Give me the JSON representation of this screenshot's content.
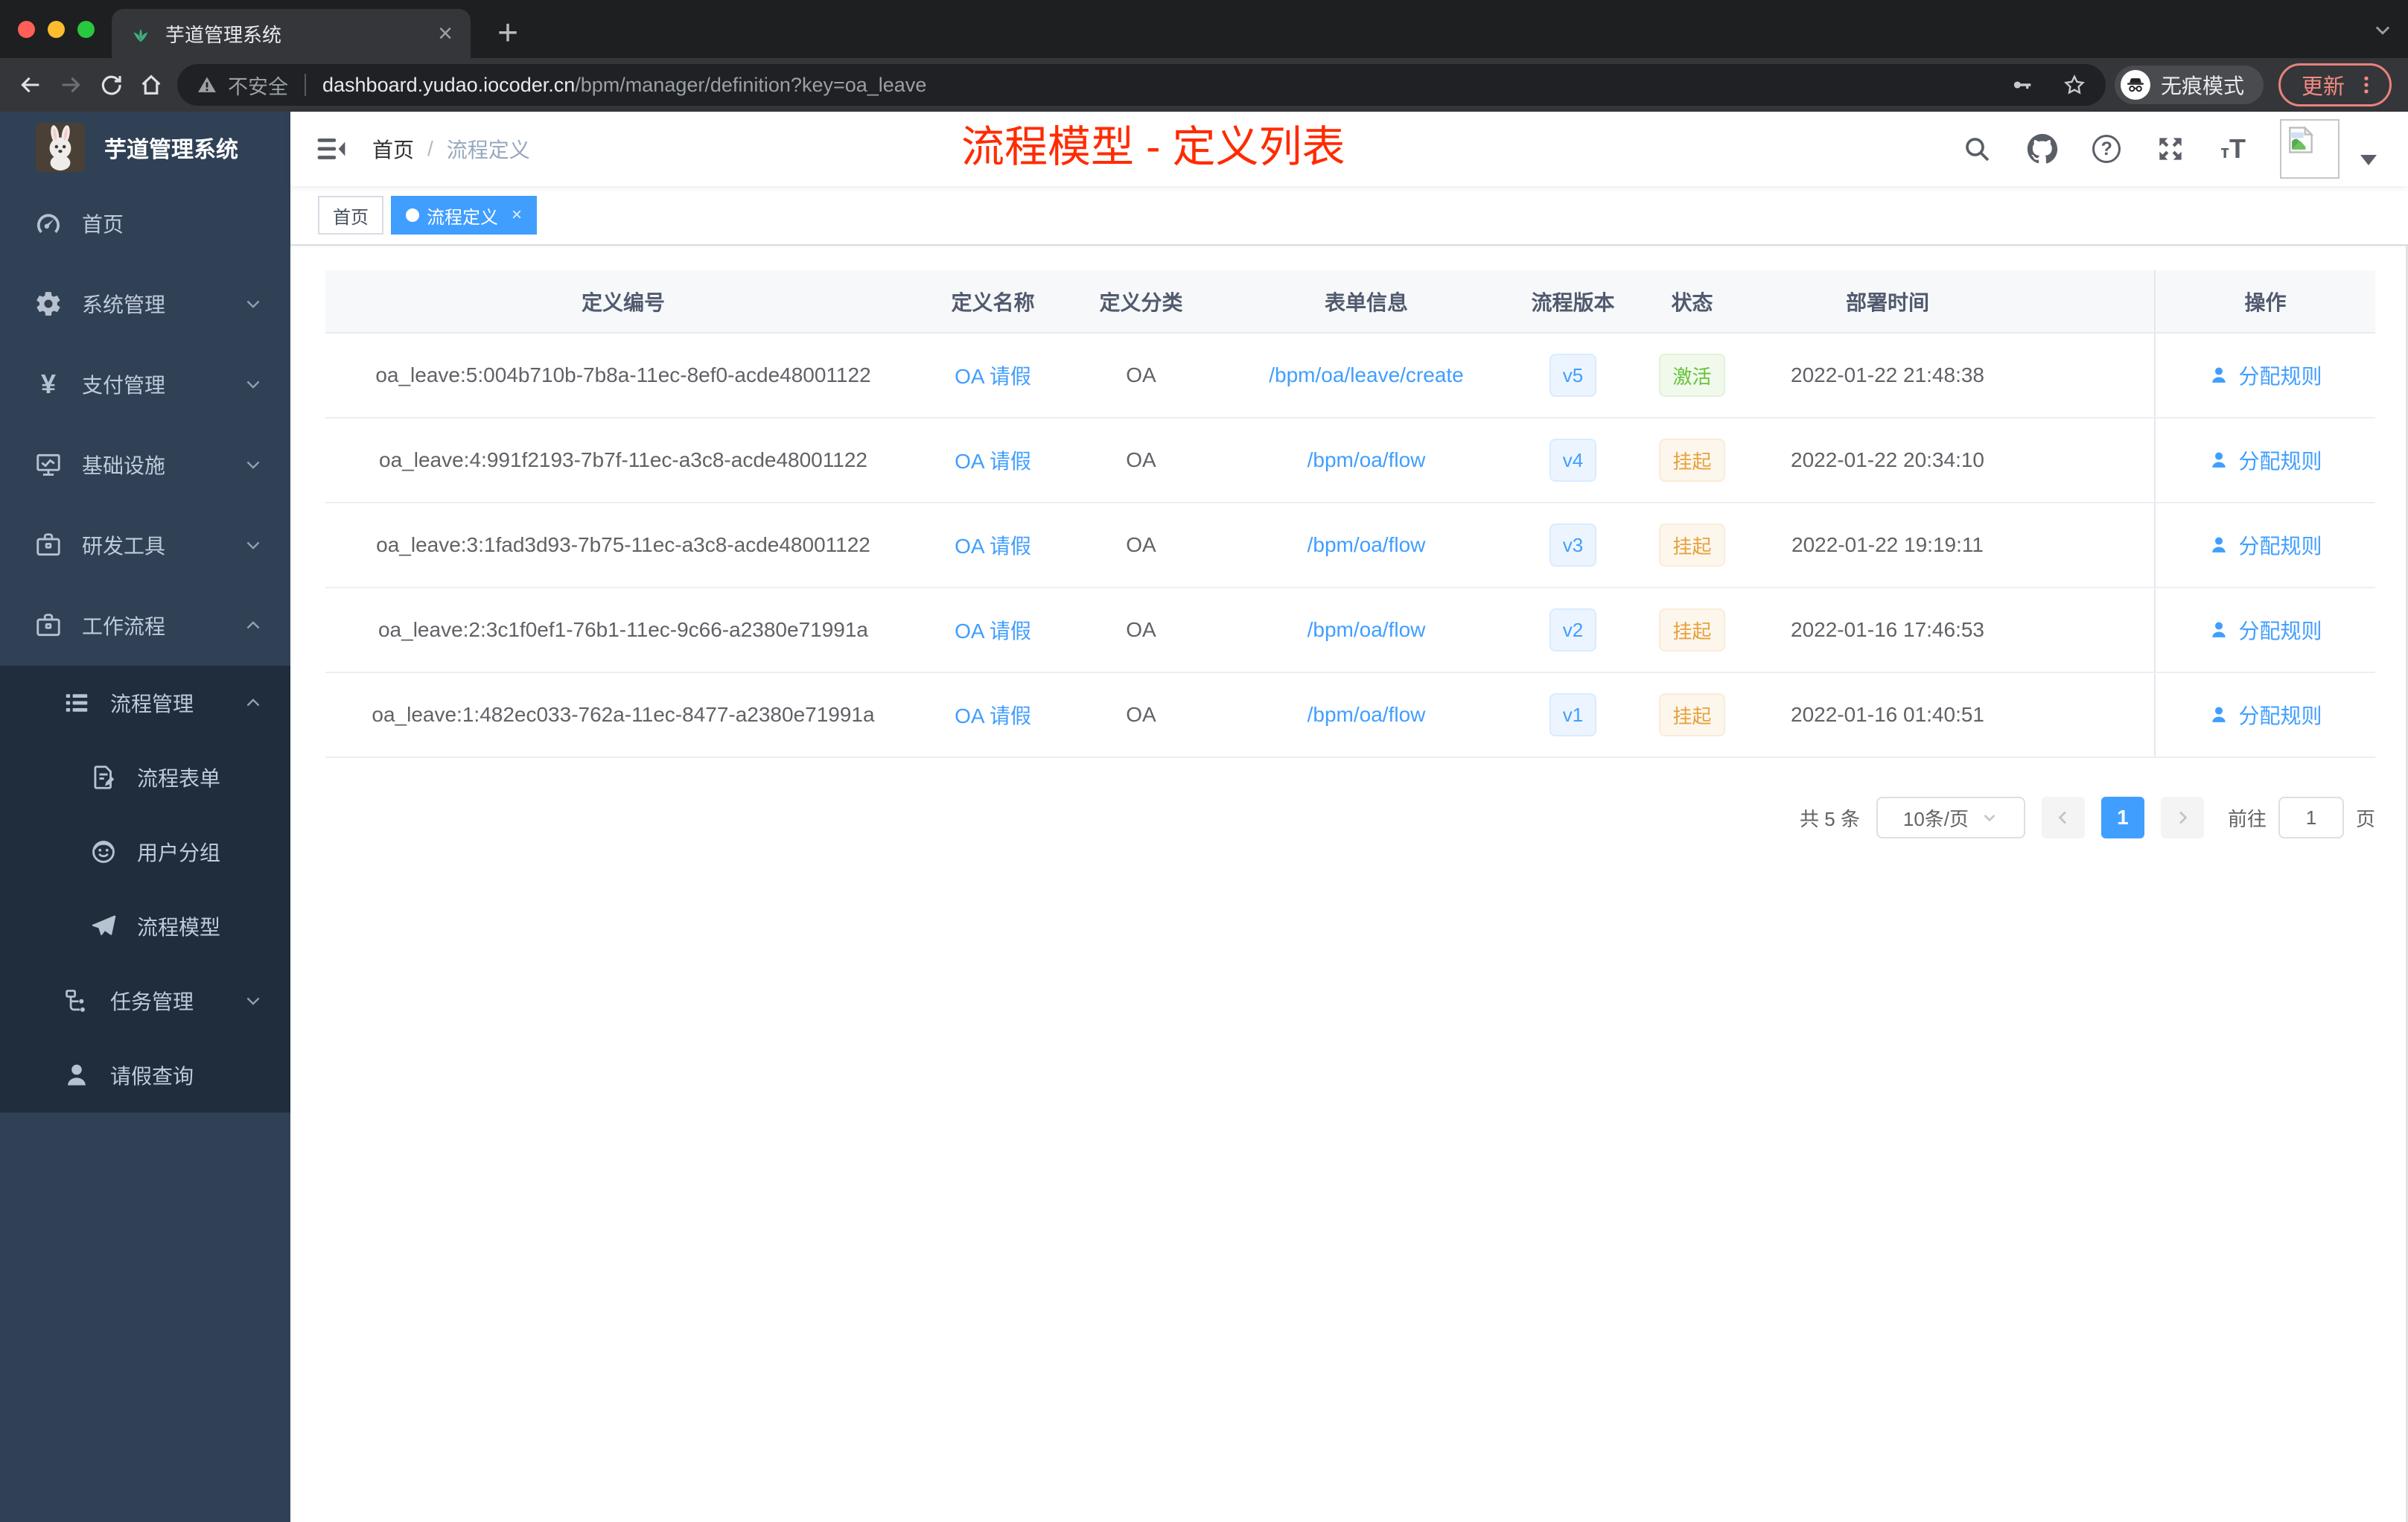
{
  "browser": {
    "tab_title": "芋道管理系统",
    "security_label": "不安全",
    "url_domain": "dashboard.yudao.iocoder.cn",
    "url_path": "/bpm/manager/definition?key=oa_leave",
    "incognito_label": "无痕模式",
    "update_label": "更新",
    "icons": [
      "back-icon",
      "forward-icon",
      "reload-icon",
      "home-icon",
      "warning-icon",
      "key-icon",
      "star-icon",
      "incognito-icon",
      "more-dots-icon",
      "tab-leaf-favicon-icon",
      "close-icon",
      "new-tab-icon",
      "tab-search-icon"
    ]
  },
  "sidebar": {
    "logo_title": "芋道管理系统",
    "items": [
      {
        "label": "首页",
        "icon": "dashboard-icon",
        "level": 1,
        "chevron": null
      },
      {
        "label": "系统管理",
        "icon": "gear-icon",
        "level": 1,
        "chevron": "down"
      },
      {
        "label": "支付管理",
        "icon": "yen-icon",
        "level": 1,
        "chevron": "down"
      },
      {
        "label": "基础设施",
        "icon": "monitor-chart-icon",
        "level": 1,
        "chevron": "down"
      },
      {
        "label": "研发工具",
        "icon": "toolbox-icon",
        "level": 1,
        "chevron": "down"
      },
      {
        "label": "工作流程",
        "icon": "briefcase-icon",
        "level": 1,
        "chevron": "up"
      },
      {
        "label": "流程管理",
        "icon": "list-icon",
        "level": 2,
        "chevron": "up"
      },
      {
        "label": "流程表单",
        "icon": "form-edit-icon",
        "level": 3,
        "chevron": null
      },
      {
        "label": "用户分组",
        "icon": "user-group-icon",
        "level": 3,
        "chevron": null
      },
      {
        "label": "流程模型",
        "icon": "paper-plane-icon",
        "level": 3,
        "chevron": null
      },
      {
        "label": "任务管理",
        "icon": "org-tree-icon",
        "level": 2,
        "chevron": "down"
      },
      {
        "label": "请假查询",
        "icon": "user-icon",
        "level": 2,
        "chevron": null
      }
    ]
  },
  "header": {
    "breadcrumb_home": "首页",
    "breadcrumb_separator": "/",
    "breadcrumb_current": "流程定义",
    "annotation": "流程模型 - 定义列表",
    "icons": [
      "hamburger-icon",
      "search-icon",
      "github-icon",
      "help-icon",
      "fullscreen-icon",
      "font-size-icon",
      "avatar-broken-image-icon",
      "caret-down-icon"
    ]
  },
  "tags": {
    "home": "首页",
    "active": "流程定义"
  },
  "table": {
    "columns": [
      "定义编号",
      "定义名称",
      "定义分类",
      "表单信息",
      "流程版本",
      "状态",
      "部署时间",
      "操作"
    ],
    "rows": [
      {
        "id": "oa_leave:5:004b710b-7b8a-11ec-8ef0-acde48001122",
        "name": "OA 请假",
        "category": "OA",
        "form": "/bpm/oa/leave/create",
        "version": "v5",
        "status": "激活",
        "status_type": "success",
        "deploy_time": "2022-01-22 21:48:38",
        "action": "分配规则"
      },
      {
        "id": "oa_leave:4:991f2193-7b7f-11ec-a3c8-acde48001122",
        "name": "OA 请假",
        "category": "OA",
        "form": "/bpm/oa/flow",
        "version": "v4",
        "status": "挂起",
        "status_type": "warning",
        "deploy_time": "2022-01-22 20:34:10",
        "action": "分配规则"
      },
      {
        "id": "oa_leave:3:1fad3d93-7b75-11ec-a3c8-acde48001122",
        "name": "OA 请假",
        "category": "OA",
        "form": "/bpm/oa/flow",
        "version": "v3",
        "status": "挂起",
        "status_type": "warning",
        "deploy_time": "2022-01-22 19:19:11",
        "action": "分配规则"
      },
      {
        "id": "oa_leave:2:3c1f0ef1-76b1-11ec-9c66-a2380e71991a",
        "name": "OA 请假",
        "category": "OA",
        "form": "/bpm/oa/flow",
        "version": "v2",
        "status": "挂起",
        "status_type": "warning",
        "deploy_time": "2022-01-16 17:46:53",
        "action": "分配规则"
      },
      {
        "id": "oa_leave:1:482ec033-762a-11ec-8477-a2380e71991a",
        "name": "OA 请假",
        "category": "OA",
        "form": "/bpm/oa/flow",
        "version": "v1",
        "status": "挂起",
        "status_type": "warning",
        "deploy_time": "2022-01-16 01:40:51",
        "action": "分配规则"
      }
    ]
  },
  "pagination": {
    "total": "共 5 条",
    "page_size": "10条/页",
    "current_page": "1",
    "goto_label": "前往",
    "goto_value": "1",
    "page_unit": "页"
  },
  "colors": {
    "accent": "#409eff",
    "annotation_red": "#ff2b00",
    "sidebar_bg": "#304156",
    "submenu_bg": "#1f2d3d",
    "success_text": "#67c23a",
    "warning_text": "#e6a23c",
    "version_text": "#409eff"
  }
}
